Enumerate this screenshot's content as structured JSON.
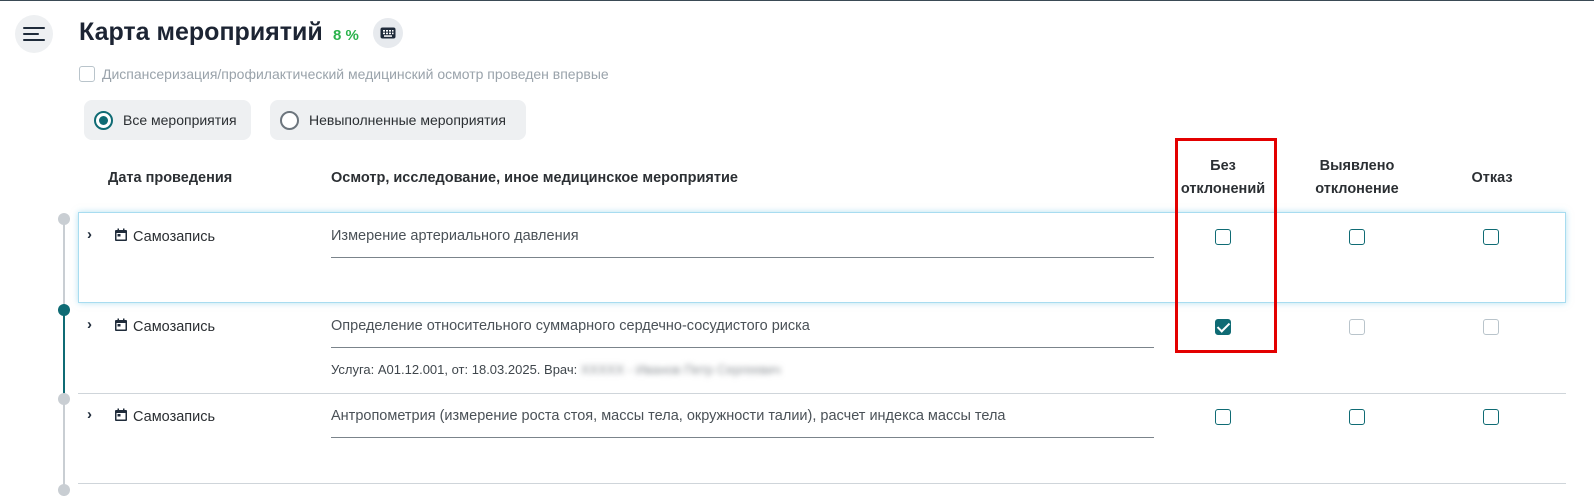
{
  "header": {
    "title": "Карта мероприятий",
    "percent": "8 %"
  },
  "first_time_checkbox": {
    "label": "Диспансеризация/профилактический медицинский осмотр проведен впервые",
    "checked": false
  },
  "filters": [
    {
      "label": "Все мероприятия",
      "selected": true
    },
    {
      "label": "Невыполненные мероприятия",
      "selected": false
    }
  ],
  "table": {
    "columns": {
      "date": "Дата проведения",
      "event": "Осмотр, исследование, иное медицинское мероприятие",
      "no_deviation_1": "Без",
      "no_deviation_2": "отклонений",
      "deviation_1": "Выявлено",
      "deviation_2": "отклонение",
      "refusal": "Отказ"
    },
    "rows": [
      {
        "date": "Самозапись",
        "event": "Измерение артериального давления",
        "service": "",
        "no_deviation": false,
        "deviation": false,
        "refusal": false
      },
      {
        "date": "Самозапись",
        "event": "Определение относительного суммарного сердечно-сосудистого риска",
        "service": "Услуга: A01.12.001, от: 18.03.2025. Врач:",
        "doctor_hidden": "XXXXX - Иванов Петр Сергеевич",
        "no_deviation": true,
        "deviation": false,
        "refusal": false
      },
      {
        "date": "Самозапись",
        "event": "Антропометрия (измерение роста стоя, массы тела, окружности талии), расчет индекса массы тела",
        "service": "",
        "no_deviation": false,
        "deviation": false,
        "refusal": false
      }
    ]
  },
  "colors": {
    "accent": "#0f6b74",
    "percent": "#2bb24c",
    "highlight": "#e30000"
  },
  "icons": {
    "menu": "menu-icon",
    "keyboard": "keyboard-icon",
    "calendar": "calendar-icon",
    "expand": "chevron-right-icon"
  }
}
